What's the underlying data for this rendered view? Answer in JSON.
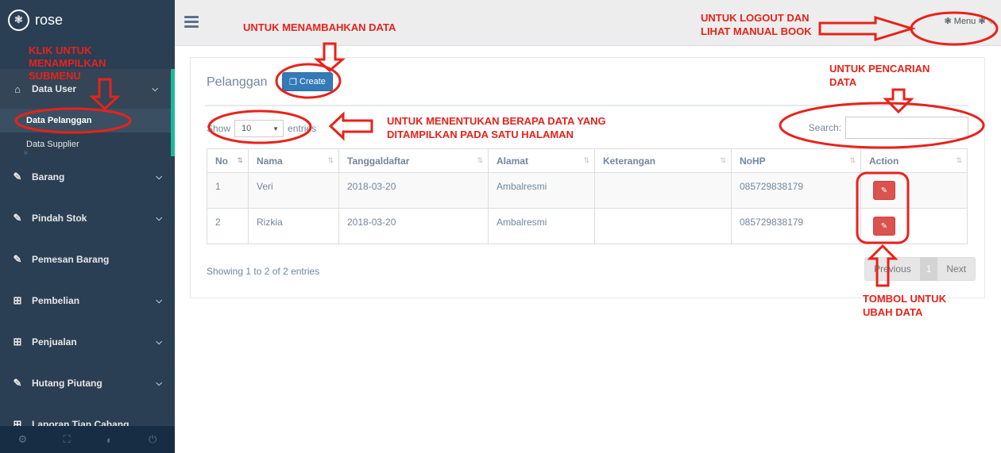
{
  "brand": {
    "name": "rose",
    "logo_icon": "paw-icon"
  },
  "sidebar": {
    "items": [
      {
        "label": "Data User",
        "icon": "home-icon",
        "chevron": true
      },
      {
        "label": "Barang",
        "icon": "edit-icon",
        "chevron": true
      },
      {
        "label": "Pindah Stok",
        "icon": "edit-icon",
        "chevron": true
      },
      {
        "label": "Pemesan Barang",
        "icon": "edit-icon",
        "chevron": false
      },
      {
        "label": "Pembelian",
        "icon": "table-icon",
        "chevron": true
      },
      {
        "label": "Penjualan",
        "icon": "table-icon",
        "chevron": true
      },
      {
        "label": "Hutang Piutang",
        "icon": "edit-icon",
        "chevron": true
      },
      {
        "label": "Laporan Tiap Cabang",
        "icon": "table-icon",
        "chevron": false
      }
    ],
    "submenu": [
      {
        "label": "Data Pelanggan"
      },
      {
        "label": "Data Supplier"
      }
    ],
    "footer_icons": [
      "settings-icon",
      "fullscreen-icon",
      "hide-icon",
      "power-icon"
    ]
  },
  "topbar": {
    "menu_label": "Menu"
  },
  "panel": {
    "title": "Pelanggan",
    "create_label": "Create",
    "length_prefix": "Show",
    "length_value": "10",
    "length_suffix": "entries",
    "search_label": "Search:",
    "search_value": "",
    "columns": [
      "No",
      "Nama",
      "Tanggaldaftar",
      "Alamat",
      "Keterangan",
      "NoHP",
      "Action"
    ],
    "rows": [
      {
        "no": "1",
        "nama": "Veri",
        "tanggal": "2018-03-20",
        "alamat": "Ambalresmi",
        "keterangan": "",
        "nohp": "085729838179"
      },
      {
        "no": "2",
        "nama": "Rizkia",
        "tanggal": "2018-03-20",
        "alamat": "Ambalresmi",
        "keterangan": "",
        "nohp": "085729838179"
      }
    ],
    "info": "Showing 1 to 2 of 2 entries",
    "pager": {
      "prev": "Previous",
      "page": "1",
      "next": "Next"
    }
  },
  "annotations": {
    "tambah": "UNTUK MENAMBAHKAN DATA",
    "logout": "UNTUK LOGOUT DAN\nLIHAT MANUAL BOOK",
    "submenu": "KLIK UNTUK\nMENAMPILKAN\nSUBMENU",
    "pencarian": "UNTUK PENCARIAN\nDATA",
    "menentukan": "UNTUK MENENTUKAN BERAPA DATA YANG\nDITAMPILKAN PADA SATU HALAMAN",
    "ubah": "TOMBOL UNTUK\nUBAH DATA"
  },
  "colors": {
    "sidebar": "#2a3f54",
    "accent": "#1abb9c",
    "annotation": "#e8221b",
    "create": "#337ab7",
    "edit": "#d9534f"
  }
}
